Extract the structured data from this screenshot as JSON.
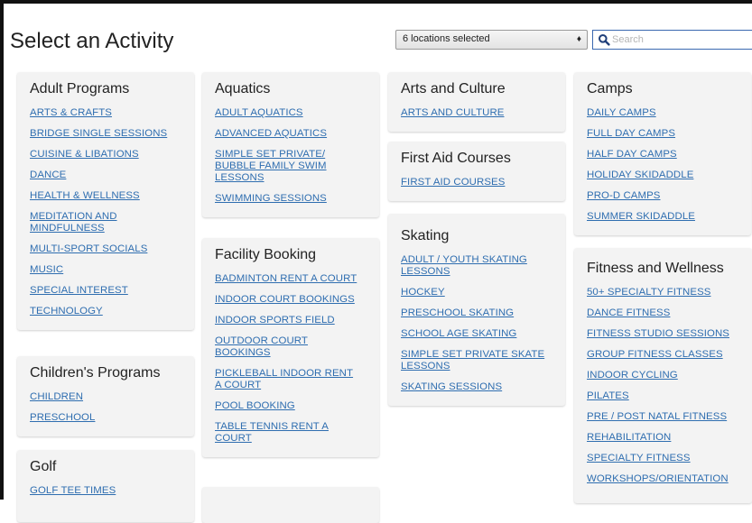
{
  "page_title": "Select an Activity",
  "location_select": {
    "value": "6 locations selected"
  },
  "search": {
    "placeholder": "Search"
  },
  "categories": [
    {
      "title": "Adult Programs",
      "items": [
        "ARTS & CRAFTS",
        "BRIDGE SINGLE SESSIONS",
        "CUISINE & LIBATIONS",
        "DANCE",
        "HEALTH & WELLNESS",
        "MEDITATION AND MINDFULNESS",
        "MULTI-SPORT SOCIALS",
        "MUSIC",
        "SPECIAL INTEREST",
        "TECHNOLOGY"
      ]
    },
    {
      "title": "Children's Programs",
      "items": [
        "CHILDREN",
        "PRESCHOOL"
      ]
    },
    {
      "title": "Golf",
      "items": [
        "GOLF TEE TIMES"
      ]
    },
    {
      "title": "Aquatics",
      "items": [
        "ADULT AQUATICS",
        "ADVANCED AQUATICS",
        "SIMPLE SET PRIVATE/ BUBBLE FAMILY SWIM LESSONS",
        "SWIMMING SESSIONS"
      ]
    },
    {
      "title": "Facility Booking",
      "items": [
        "BADMINTON RENT A COURT",
        "INDOOR COURT BOOKINGS",
        "INDOOR SPORTS FIELD",
        "OUTDOOR COURT BOOKINGS",
        "PICKLEBALL INDOOR RENT A COURT",
        "POOL BOOKING",
        "TABLE TENNIS RENT A COURT"
      ]
    },
    {
      "title": "Arts and Culture",
      "items": [
        "ARTS AND CULTURE"
      ]
    },
    {
      "title": "First Aid Courses",
      "items": [
        "FIRST AID COURSES"
      ]
    },
    {
      "title": "Skating",
      "items": [
        "ADULT / YOUTH SKATING LESSONS",
        "HOCKEY",
        "PRESCHOOL SKATING",
        "SCHOOL AGE SKATING",
        "SIMPLE SET PRIVATE SKATE LESSONS",
        "SKATING SESSIONS"
      ]
    },
    {
      "title": "Camps",
      "items": [
        "DAILY CAMPS",
        "FULL DAY CAMPS",
        "HALF DAY CAMPS",
        "HOLIDAY SKIDADDLE",
        "PRO-D CAMPS",
        "SUMMER SKIDADDLE"
      ]
    },
    {
      "title": "Fitness and Wellness",
      "items": [
        "50+ SPECIALTY FITNESS",
        "DANCE FITNESS",
        "FITNESS STUDIO SESSIONS",
        "GROUP FITNESS CLASSES",
        "INDOOR CYCLING",
        "PILATES",
        "PRE / POST NATAL FITNESS",
        "REHABILITATION",
        "SPECIALTY FITNESS",
        "WORKSHOPS/ORIENTATION"
      ]
    }
  ]
}
